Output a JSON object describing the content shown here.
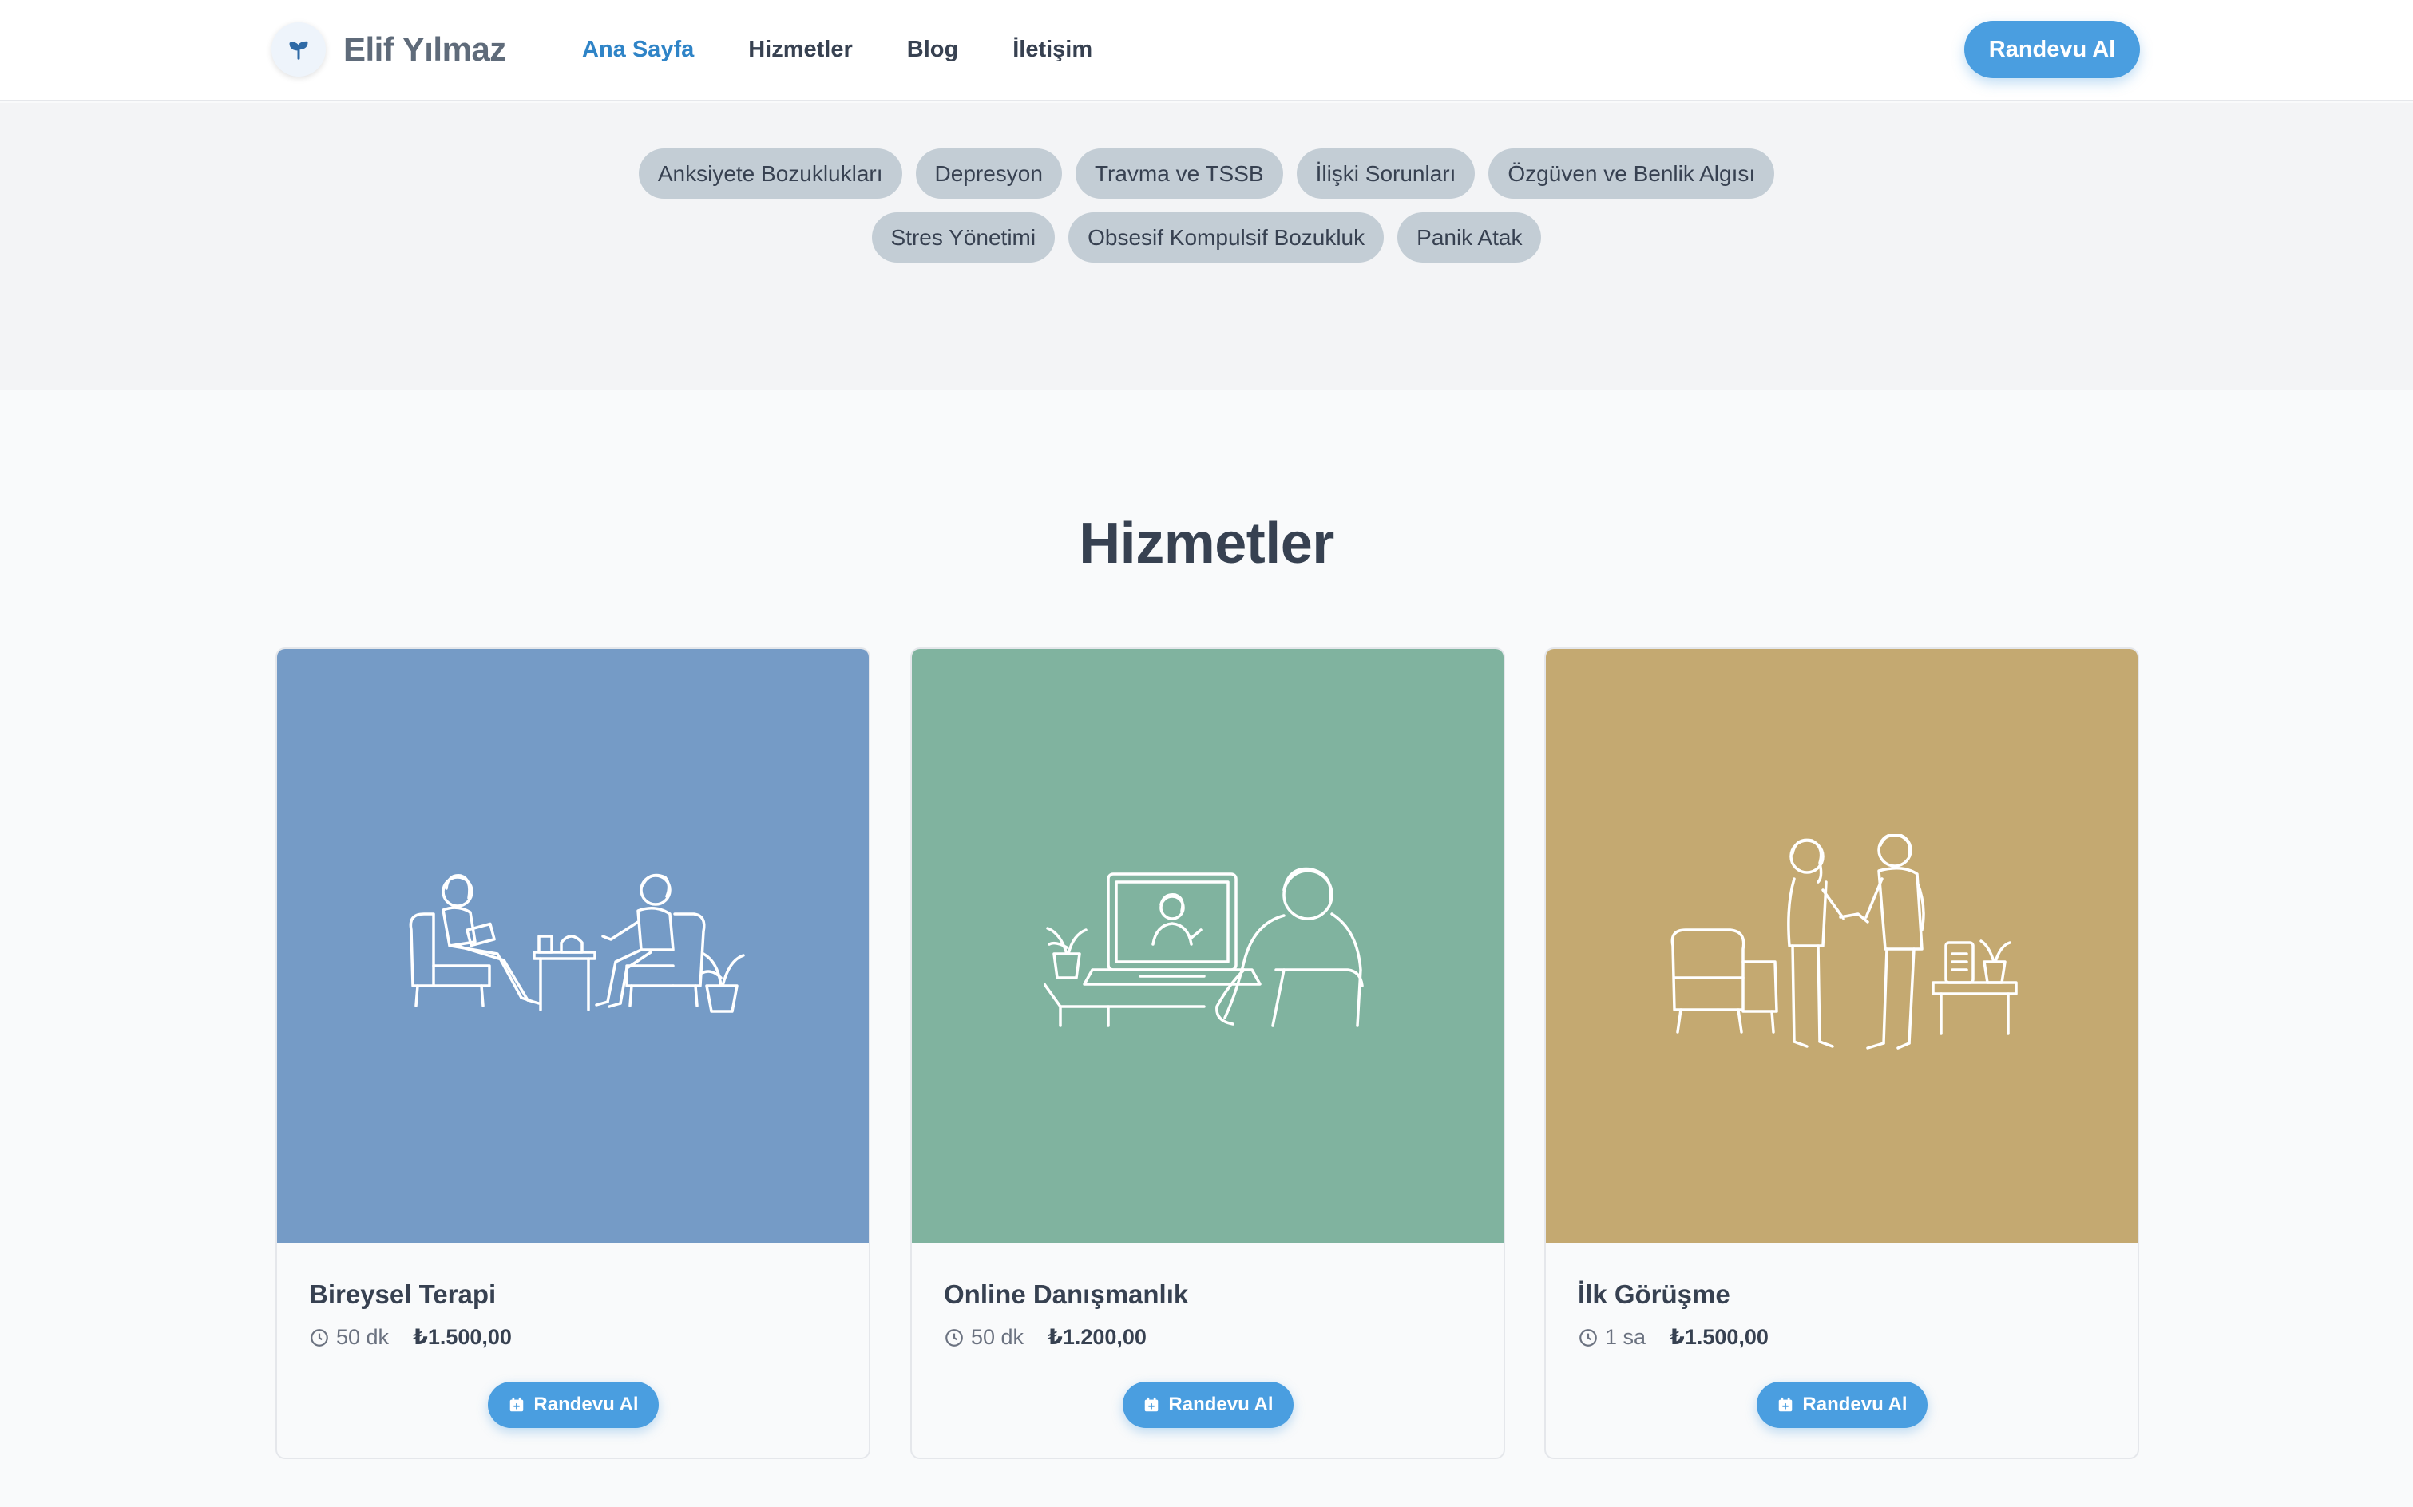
{
  "brand": {
    "name": "Elif Yılmaz",
    "icon": "sprout-icon"
  },
  "nav": {
    "items": [
      {
        "label": "Ana Sayfa",
        "active": true
      },
      {
        "label": "Hizmetler",
        "active": false
      },
      {
        "label": "Blog",
        "active": false
      },
      {
        "label": "İletişim",
        "active": false
      }
    ]
  },
  "header": {
    "cta_label": "Randevu Al"
  },
  "tags": {
    "row1": [
      "Anksiyete Bozuklukları",
      "Depresyon",
      "Travma ve TSSB",
      "İlişki Sorunları",
      "Özgüven ve Benlik Algısı"
    ],
    "row2": [
      "Stres Yönetimi",
      "Obsesif Kompulsif Bozukluk",
      "Panik Atak"
    ]
  },
  "services": {
    "title": "Hizmetler",
    "cards": [
      {
        "title": "Bireysel Terapi",
        "duration": "50 dk",
        "price": "₺1.500,00",
        "button": "Randevu Al",
        "color": "#759bc6",
        "illustration": "therapy-session-illustration"
      },
      {
        "title": "Online Danışmanlık",
        "duration": "50 dk",
        "price": "₺1.200,00",
        "button": "Randevu Al",
        "color": "#80b39f",
        "illustration": "online-session-illustration"
      },
      {
        "title": "İlk Görüşme",
        "duration": "1 sa",
        "price": "₺1.500,00",
        "button": "Randevu Al",
        "color": "#c4a971",
        "illustration": "handshake-illustration"
      }
    ]
  },
  "colors": {
    "accent": "#4a9ee0",
    "nav_active": "#2f84c7",
    "tag_bg": "#c3cdd5",
    "text": "#374151"
  }
}
